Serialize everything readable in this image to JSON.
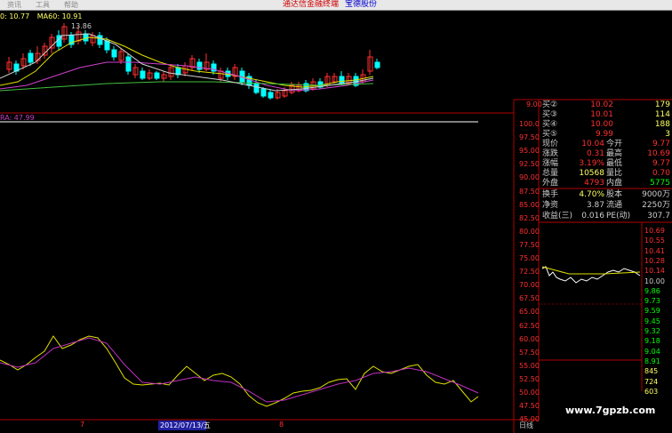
{
  "menu": {
    "items": [
      "资讯",
      "工具",
      "帮助"
    ],
    "brand": "通达信金融终端",
    "stock_name": "宝德股份"
  },
  "main_chart": {
    "ma_labels": [
      "0: 10.77",
      "MA60: 10.91"
    ],
    "high_annotation": "13.86"
  },
  "indicator": {
    "label": "RA: 47.99",
    "axis_ticks": [
      "100.0",
      "97.50",
      "95.00",
      "92.50",
      "90.00",
      "87.50",
      "85.00",
      "82.50",
      "80.00",
      "77.50",
      "75.00",
      "72.50",
      "70.00",
      "67.50",
      "65.00",
      "62.50",
      "60.00",
      "57.50",
      "55.00",
      "52.50",
      "50.00",
      "47.50",
      "45.00"
    ]
  },
  "price_axis_top": "9.00",
  "order_book": {
    "rows": [
      {
        "label": "买②",
        "price": "10.02",
        "vol": "179"
      },
      {
        "label": "买③",
        "price": "10.01",
        "vol": "114"
      },
      {
        "label": "买④",
        "price": "10.00",
        "vol": "188"
      },
      {
        "label": "买⑤",
        "price": "9.99",
        "vol": "3"
      }
    ]
  },
  "quote": {
    "rows": [
      {
        "l1": "现价",
        "v1": "10.04",
        "l2": "今开",
        "v2": "9.77"
      },
      {
        "l1": "涨跌",
        "v1": "0.31",
        "l2": "最高",
        "v2": "10.69"
      },
      {
        "l1": "涨幅",
        "v1": "3.19%",
        "l2": "最低",
        "v2": "9.77"
      },
      {
        "l1": "总量",
        "v1": "10568",
        "l2": "量比",
        "v2": "0.70"
      },
      {
        "l1": "外盘",
        "v1": "4793",
        "l2": "内盘",
        "v2": "5775"
      }
    ],
    "fund_rows": [
      {
        "l1": "换手",
        "v1": "4.70%",
        "l2": "股本",
        "v2": "9000万"
      },
      {
        "l1": "净资",
        "v1": "3.87",
        "l2": "流通",
        "v2": "2250万"
      },
      {
        "l1": "收益(三)",
        "v1": "0.016",
        "l2": "PE(动)",
        "v2": "307.7"
      }
    ]
  },
  "mini_chart": {
    "right_ticks": [
      "10.69",
      "10.55",
      "10.41",
      "10.28",
      "10.14",
      "10.00",
      "9.86",
      "9.73",
      "9.59",
      "9.45",
      "9.32",
      "9.18",
      "9.04",
      "8.91",
      "845",
      "724",
      "603"
    ]
  },
  "date_axis": {
    "left_label": "7",
    "date_label": "2012/07/13/五",
    "right_label": "8",
    "period": "日线"
  },
  "watermark": "www.7gpzb.com",
  "colors": {
    "up": "#ff3030",
    "down": "#00ffff",
    "accent": "#c040c0",
    "border": "#b00000"
  }
}
